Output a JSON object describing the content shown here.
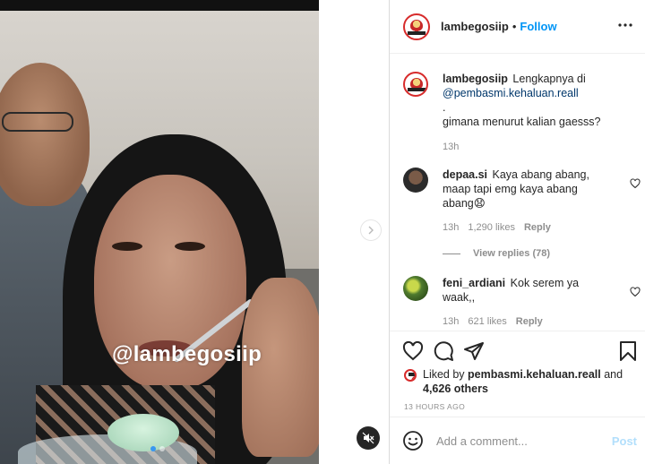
{
  "media": {
    "watermark": "@lambegosiip",
    "mute_icon": "speaker-muted-icon",
    "next_icon": "chevron-right-icon",
    "carousel_active_index": 0,
    "carousel_count": 2
  },
  "post": {
    "author": "lambegosiip",
    "follow_label": "Follow",
    "separator": "•",
    "more_icon": "ellipsis-icon"
  },
  "caption": {
    "username": "lambegosiip",
    "text_before": "Lengkapnya di",
    "mention": "@pembasmi.kehaluan.reall",
    "line2": ".",
    "line3": "gimana menurut kalian gaesss?",
    "time": "13h"
  },
  "comments": [
    {
      "username": "depaa.si",
      "text": "Kaya abang abang, maap tapi emg kaya abang abang😧",
      "time": "13h",
      "likes": "1,290 likes",
      "reply_label": "Reply"
    },
    {
      "username": "feni_ardiani",
      "text": "Kok serem ya waak,,",
      "time": "13h",
      "likes": "621 likes",
      "reply_label": "Reply"
    }
  ],
  "view_replies_label": "View replies (78)",
  "actions": {
    "like_icon": "heart-icon",
    "comment_icon": "comment-icon",
    "share_icon": "paper-plane-icon",
    "save_icon": "bookmark-icon"
  },
  "liked_by": {
    "prefix": "Liked by",
    "user": "pembasmi.kehaluan.reall",
    "and": "and",
    "others": "4,626 others"
  },
  "timestamp": "13 HOURS AGO",
  "add_comment": {
    "placeholder": "Add a comment...",
    "emoji_icon": "smiley-icon",
    "post_label": "Post"
  },
  "colors": {
    "link": "#0095f6",
    "mention": "#00376b",
    "post_disabled": "#b2dffc",
    "muted_text": "#8e8e8e"
  }
}
